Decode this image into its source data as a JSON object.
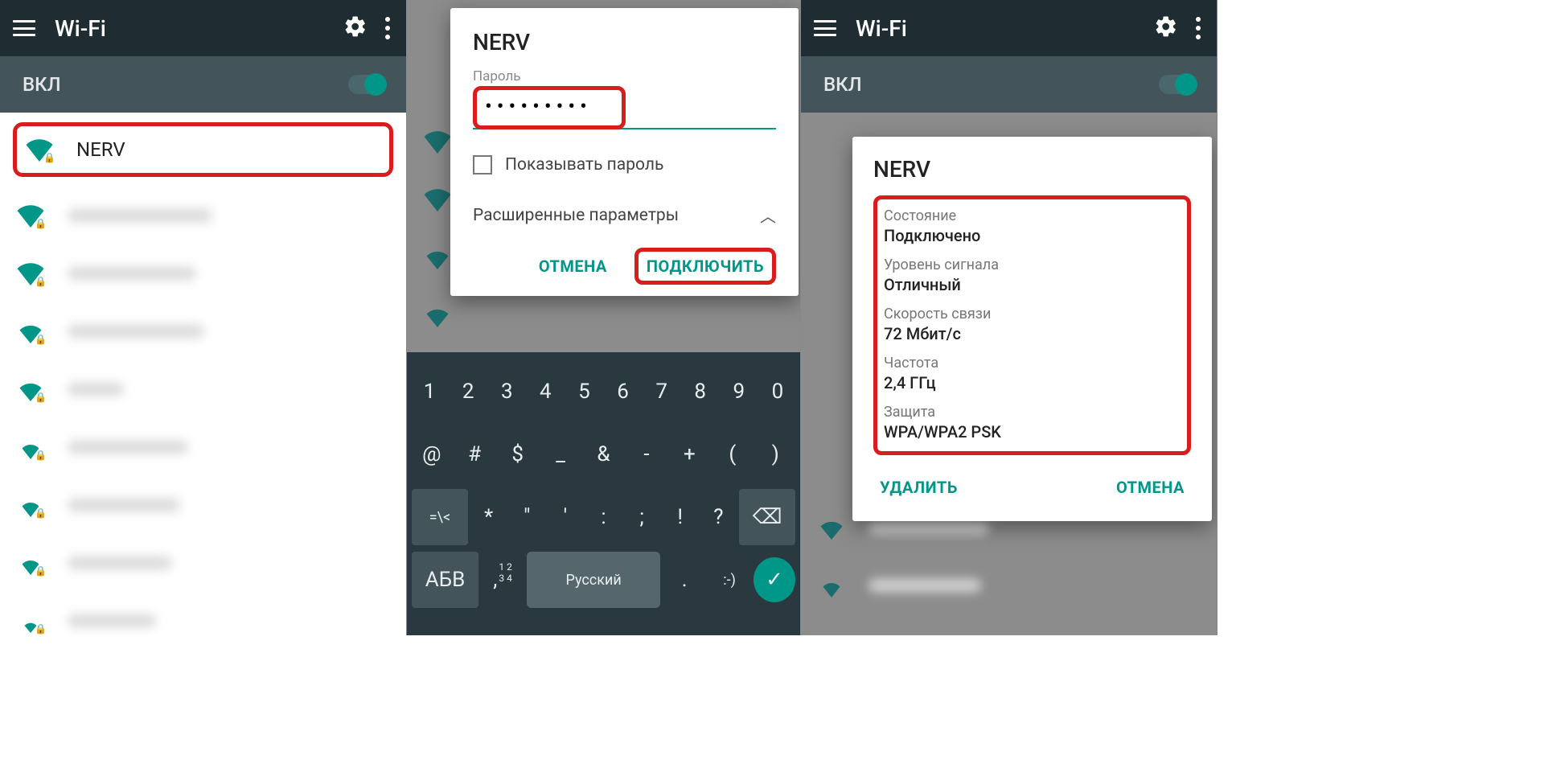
{
  "colors": {
    "accent": "#009688",
    "highlight": "#d81d1d",
    "toolbar": "#1f2d33",
    "subbar": "#43545b"
  },
  "p1": {
    "title": "Wi-Fi",
    "on": "ВКЛ",
    "net": "NERV"
  },
  "p2": {
    "dialog_title": "NERV",
    "pw_label": "Пароль",
    "pw_masked": "•••••••••",
    "show_pw": "Показывать пароль",
    "advanced": "Расширенные параметры",
    "cancel": "ОТМЕНА",
    "connect": "ПОДКЛЮЧИТЬ",
    "kbd": {
      "r1": [
        "1",
        "2",
        "3",
        "4",
        "5",
        "6",
        "7",
        "8",
        "9",
        "0"
      ],
      "r2": [
        "@",
        "#",
        "$",
        "_",
        "&",
        "-",
        "+",
        "(",
        ")"
      ],
      "r3_shift": "=\\<",
      "r3": [
        "*",
        "\"",
        "'",
        ":",
        ";",
        "!",
        "?"
      ],
      "r3_bs": "⌫",
      "r4_mode": "АБВ",
      "r4_comma": ",",
      "r4_space": "Русский",
      "r4_dot": ".",
      "r4_emoji": ":-)"
    }
  },
  "p3": {
    "title": "Wi-Fi",
    "on": "ВКЛ",
    "dialog_title": "NERV",
    "rows": [
      {
        "l": "Состояние",
        "v": "Подключено"
      },
      {
        "l": "Уровень сигнала",
        "v": "Отличный"
      },
      {
        "l": "Скорость связи",
        "v": "72 Мбит/с"
      },
      {
        "l": "Частота",
        "v": "2,4 ГГц"
      },
      {
        "l": "Защита",
        "v": "WPA/WPA2 PSK"
      }
    ],
    "forget": "УДАЛИТЬ",
    "cancel": "ОТМЕНА"
  }
}
